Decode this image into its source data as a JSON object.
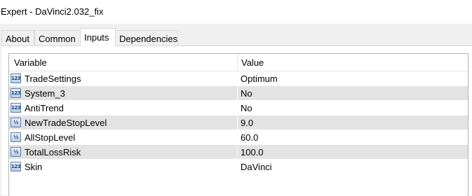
{
  "window": {
    "title": "Expert - DaVinci2.032_fix"
  },
  "tabs": [
    {
      "label": "About"
    },
    {
      "label": "Common"
    },
    {
      "label": "Inputs"
    },
    {
      "label": "Dependencies"
    }
  ],
  "active_tab": "Inputs",
  "table": {
    "columns": {
      "variable": "Variable",
      "value": "Value"
    },
    "rows": [
      {
        "icon": "123",
        "icon_name": "integer-type-icon",
        "variable": "TradeSettings",
        "value": "Optimum"
      },
      {
        "icon": "123",
        "icon_name": "integer-type-icon",
        "variable": "System_3",
        "value": "No"
      },
      {
        "icon": "123",
        "icon_name": "integer-type-icon",
        "variable": "AntiTrend",
        "value": "No"
      },
      {
        "icon": "½",
        "icon_name": "double-type-icon",
        "variable": "NewTradeStopLevel",
        "value": "9.0"
      },
      {
        "icon": "½",
        "icon_name": "double-type-icon",
        "variable": "AllStopLevel",
        "value": "60.0"
      },
      {
        "icon": "½",
        "icon_name": "double-type-icon",
        "variable": "TotalLossRisk",
        "value": "100.0"
      },
      {
        "icon": "123",
        "icon_name": "integer-type-icon",
        "variable": "Skin",
        "value": "DaVinci"
      }
    ]
  }
}
